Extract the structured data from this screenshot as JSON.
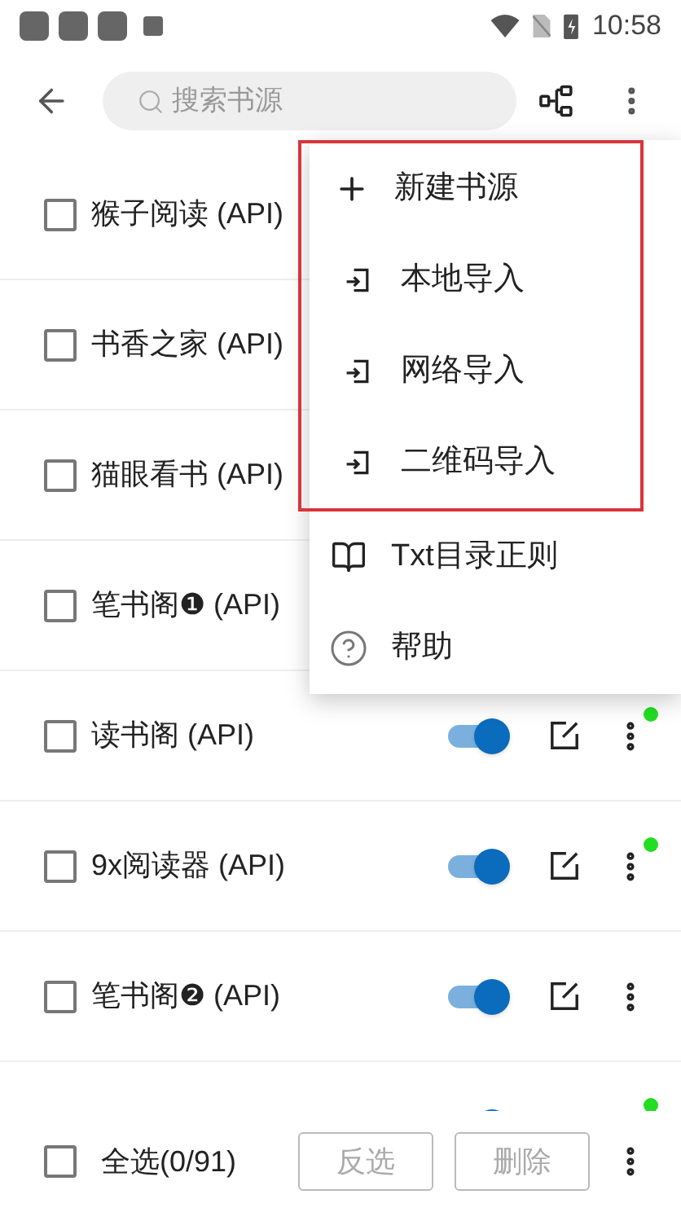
{
  "status_bar": {
    "time": "10:58"
  },
  "toolbar": {
    "search": {
      "placeholder": "搜索书源"
    }
  },
  "sources": [
    {
      "name": "猴子阅读 (API)",
      "checked": false
    },
    {
      "name": "书香之家 (API)",
      "checked": false
    },
    {
      "name": "猫眼看书 (API)",
      "checked": false
    },
    {
      "name": "笔书阁❶ (API)",
      "checked": false
    },
    {
      "name": "读书阁 (API)",
      "checked": false,
      "on": true,
      "color": "#22dd22"
    },
    {
      "name": "9x阅读器 (API)",
      "checked": false,
      "on": true,
      "color": "#22dd22"
    },
    {
      "name": "笔书阁❷ (API)",
      "checked": false,
      "on": true
    },
    {
      "on": true,
      "color": "#22dd22"
    }
  ],
  "menu": {
    "groups": [
      {
        "highlighted": true,
        "items": [
          {
            "kind": "plus",
            "label": "新建书源"
          },
          {
            "kind": "import",
            "label": "本地导入"
          },
          {
            "kind": "import",
            "label": "网络导入"
          },
          {
            "kind": "import",
            "label": "二维码导入"
          }
        ]
      },
      {
        "highlighted": false,
        "items": [
          {
            "kind": "book",
            "label": "Txt目录正则"
          },
          {
            "kind": "help",
            "label": "帮助"
          }
        ]
      }
    ]
  },
  "bottom_bar": {
    "select_all": {
      "label": "全选(0/91)",
      "checked": false
    },
    "buttons": [
      {
        "label": "反选",
        "disabled": true
      },
      {
        "label": "删除",
        "disabled": true
      }
    ]
  }
}
